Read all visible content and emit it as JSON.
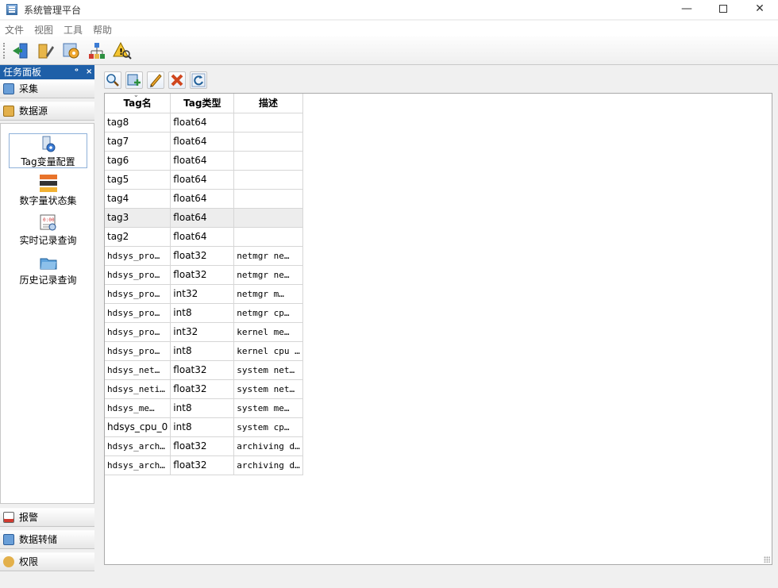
{
  "window": {
    "title": "系统管理平台",
    "min": "—",
    "close": "✕"
  },
  "menu": [
    "文件",
    "视图",
    "工具",
    "帮助"
  ],
  "panel": {
    "title": "任务面板",
    "pin": "ᵒ",
    "close": "×",
    "sections_top": [
      {
        "label": "采集",
        "icon": "collect-icon"
      },
      {
        "label": "数据源",
        "icon": "datasource-icon"
      }
    ],
    "tools": [
      {
        "label": "Tag变量配置",
        "icon": "tag-config-icon",
        "selected": true
      },
      {
        "label": "数字量状态集",
        "icon": "digital-state-icon"
      },
      {
        "label": "实时记录查询",
        "icon": "realtime-query-icon"
      },
      {
        "label": "历史记录查询",
        "icon": "history-query-icon"
      }
    ],
    "sections_bottom": [
      {
        "label": "报警",
        "icon": "alarm-icon"
      },
      {
        "label": "数据转储",
        "icon": "data-dump-icon"
      },
      {
        "label": "权限",
        "icon": "permission-icon"
      }
    ]
  },
  "table": {
    "headers": [
      "Tag名",
      "Tag类型",
      "描述"
    ],
    "selected_row": 5,
    "rows": [
      [
        "tag8",
        "float64",
        ""
      ],
      [
        "tag7",
        "float64",
        ""
      ],
      [
        "tag6",
        "float64",
        ""
      ],
      [
        "tag5",
        "float64",
        ""
      ],
      [
        "tag4",
        "float64",
        ""
      ],
      [
        "tag3",
        "float64",
        ""
      ],
      [
        "tag2",
        "float64",
        ""
      ],
      [
        "hdsys_pro…",
        "float32",
        "netmgr ne…"
      ],
      [
        "hdsys_pro…",
        "float32",
        "netmgr ne…"
      ],
      [
        "hdsys_pro…",
        "int32",
        "netmgr m…"
      ],
      [
        "hdsys_pro…",
        "int8",
        "netmgr cp…"
      ],
      [
        "hdsys_pro…",
        "int32",
        "kernel me…"
      ],
      [
        "hdsys_pro…",
        "int8",
        "kernel cpu …"
      ],
      [
        "hdsys_net…",
        "float32",
        "system net…"
      ],
      [
        "hdsys_neti…",
        "float32",
        "system net…"
      ],
      [
        "hdsys_me…",
        "int8",
        "system me…"
      ],
      [
        "hdsys_cpu_0",
        "int8",
        "system cp…"
      ],
      [
        "hdsys_arch…",
        "float32",
        "archiving d…"
      ],
      [
        "hdsys_arch…",
        "float32",
        "archiving d…"
      ]
    ],
    "mono_name_rows": [
      7,
      8,
      9,
      10,
      11,
      12,
      13,
      14,
      15,
      17,
      18
    ]
  }
}
